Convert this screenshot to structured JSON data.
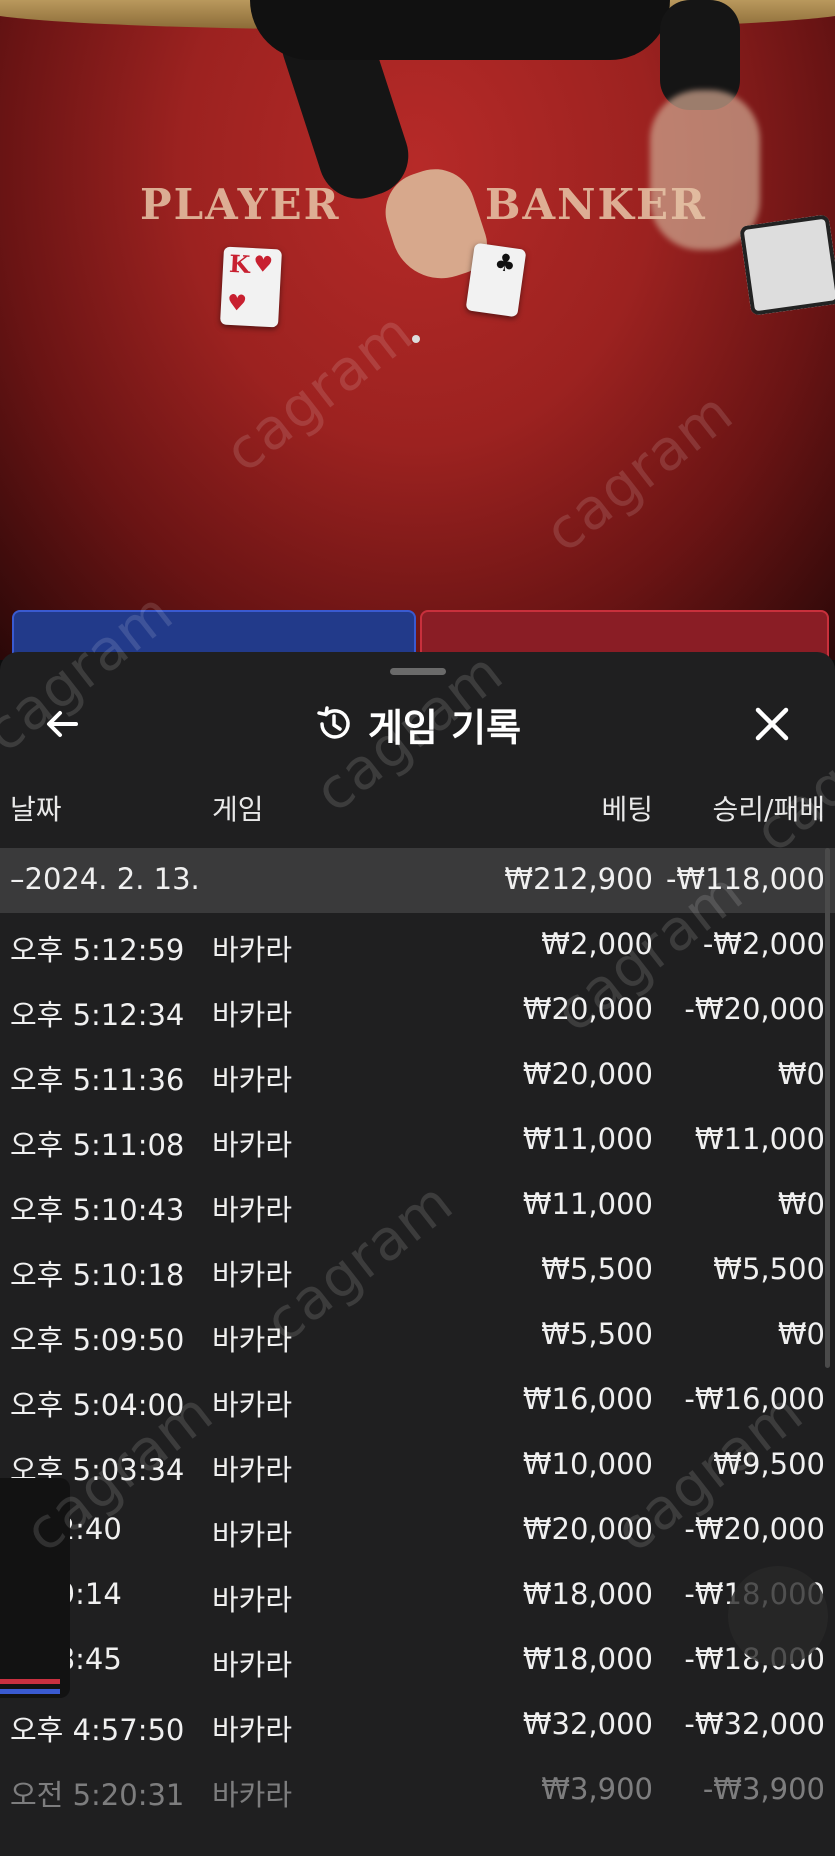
{
  "table": {
    "player_label": "PLAYER",
    "banker_label": "BANKER",
    "player_card": "K",
    "banker_card": "♣"
  },
  "watermark": "cagram",
  "sheet": {
    "title": "게임 기록",
    "icons": {
      "back": "back-arrow-icon",
      "history": "history-icon",
      "close": "close-icon"
    },
    "columns": {
      "date": "날짜",
      "game": "게임",
      "bet": "베팅",
      "result": "승리/패배"
    },
    "date_group": {
      "label": "–2024. 2. 13.",
      "bet": "₩212,900",
      "result": "-₩118,000"
    },
    "rows": [
      {
        "time": "오후 5:12:59",
        "game": "바카라",
        "bet": "₩2,000",
        "result": "-₩2,000"
      },
      {
        "time": "오후 5:12:34",
        "game": "바카라",
        "bet": "₩20,000",
        "result": "-₩20,000"
      },
      {
        "time": "오후 5:11:36",
        "game": "바카라",
        "bet": "₩20,000",
        "result": "₩0"
      },
      {
        "time": "오후 5:11:08",
        "game": "바카라",
        "bet": "₩11,000",
        "result": "₩11,000"
      },
      {
        "time": "오후 5:10:43",
        "game": "바카라",
        "bet": "₩11,000",
        "result": "₩0"
      },
      {
        "time": "오후 5:10:18",
        "game": "바카라",
        "bet": "₩5,500",
        "result": "₩5,500"
      },
      {
        "time": "오후 5:09:50",
        "game": "바카라",
        "bet": "₩5,500",
        "result": "₩0"
      },
      {
        "time": "오후 5:04:00",
        "game": "바카라",
        "bet": "₩16,000",
        "result": "-₩16,000"
      },
      {
        "time": "오후 5:03:34",
        "game": "바카라",
        "bet": "₩10,000",
        "result": "₩9,500"
      },
      {
        "time": "5:02:40",
        "game": "바카라",
        "bet": "₩20,000",
        "result": "-₩20,000"
      },
      {
        "time": "4:59:14",
        "game": "바카라",
        "bet": "₩18,000",
        "result": "-₩18,000"
      },
      {
        "time": "4:58:45",
        "game": "바카라",
        "bet": "₩18,000",
        "result": "-₩18,000"
      },
      {
        "time": "오후 4:57:50",
        "game": "바카라",
        "bet": "₩32,000",
        "result": "-₩32,000"
      },
      {
        "time": "오전 5:20:31",
        "game": "바카라",
        "bet": "₩3,900",
        "result": "-₩3,900"
      }
    ]
  }
}
